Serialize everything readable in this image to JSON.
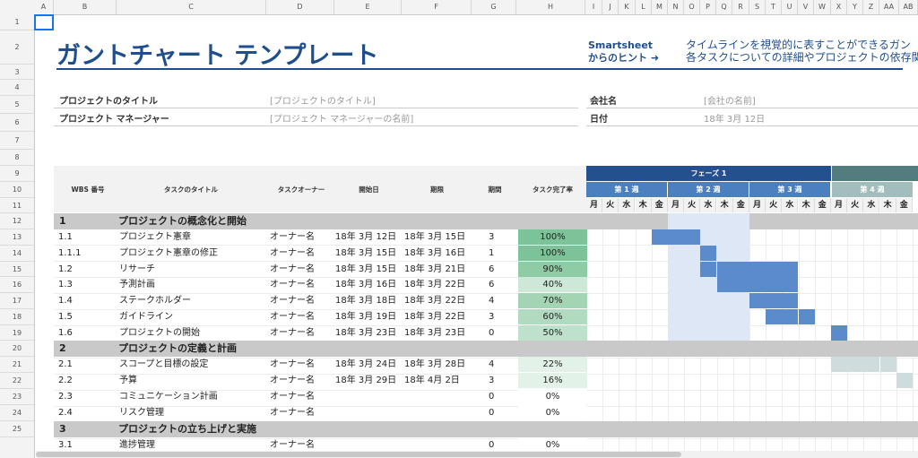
{
  "columns": [
    "A",
    "B",
    "C",
    "D",
    "E",
    "F",
    "G",
    "H",
    "I",
    "J",
    "K",
    "L",
    "M",
    "N",
    "O",
    "P",
    "Q",
    "R",
    "S",
    "T",
    "U",
    "V",
    "W",
    "X",
    "Y",
    "Z",
    "AA",
    "AB"
  ],
  "rows": [
    "1",
    "2",
    "3",
    "4",
    "5",
    "6",
    "7",
    "8",
    "9",
    "10",
    "11",
    "12",
    "13",
    "14",
    "15",
    "16",
    "17",
    "18",
    "19",
    "20",
    "21",
    "22",
    "23",
    "24",
    "25"
  ],
  "title": "ガントチャート テンプレート",
  "tip": {
    "line1": "Smartsheet",
    "line2": "からのヒント ➜",
    "text1": "タイムラインを視覚的に表すことができるガン",
    "text2": "各タスクについての詳細やプロジェクトの依存関"
  },
  "info": {
    "project_title_label": "プロジェクトのタイトル",
    "project_title_value": "[プロジェクトのタイトル]",
    "manager_label": "プロジェクト マネージャー",
    "manager_value": "[プロジェクト マネージャーの名前]",
    "company_label": "会社名",
    "company_value": "[会社の名前]",
    "date_label": "日付",
    "date_value": "18年 3月 12日"
  },
  "headers": {
    "wbs": "WBS 番号",
    "task": "タスクのタイトル",
    "owner": "タスクオーナー",
    "start": "開始日",
    "due": "期限",
    "duration": "期間",
    "pct": "タスク完了率"
  },
  "phases": [
    "フェーズ 1",
    ""
  ],
  "weeks": [
    "第 1 週",
    "第 2 週",
    "第 3 週",
    "第 4 週"
  ],
  "days": [
    "月",
    "火",
    "水",
    "木",
    "金",
    "月",
    "火",
    "水",
    "木",
    "金",
    "月",
    "火",
    "水",
    "木",
    "金",
    "月",
    "火",
    "水",
    "木",
    "金"
  ],
  "colors": {
    "accent": "#1f4e8c",
    "phase1": "#25508f",
    "phase2": "#527c7e",
    "week": "#4a7fc0",
    "week4": "#a3bdbd",
    "bar": "#5b8bcb",
    "bar_teal": "#cfdcdd",
    "highlight": "#dde7f5"
  },
  "sections": [
    {
      "wbs": "1",
      "title": "プロジェクトの概念化と開始"
    },
    {
      "wbs": "2",
      "title": "プロジェクトの定義と計画"
    },
    {
      "wbs": "3",
      "title": "プロジェクトの立ち上げと実施"
    }
  ],
  "tasks": [
    {
      "wbs": "1.1",
      "task": "プロジェクト憲章",
      "owner": "オーナー名",
      "start": "18年 3月 12日",
      "due": "18年 3月 15日",
      "duration": "3",
      "pct": "100%",
      "pct_value": 1.0
    },
    {
      "wbs": "1.1.1",
      "task": "プロジェクト憲章の修正",
      "owner": "オーナー名",
      "start": "18年 3月 15日",
      "due": "18年 3月 16日",
      "duration": "1",
      "pct": "100%",
      "pct_value": 1.0
    },
    {
      "wbs": "1.2",
      "task": "リサーチ",
      "owner": "オーナー名",
      "start": "18年 3月 15日",
      "due": "18年 3月 21日",
      "duration": "6",
      "pct": "90%",
      "pct_value": 0.9
    },
    {
      "wbs": "1.3",
      "task": "予測計画",
      "owner": "オーナー名",
      "start": "18年 3月 16日",
      "due": "18年 3月 22日",
      "duration": "6",
      "pct": "40%",
      "pct_value": 0.4
    },
    {
      "wbs": "1.4",
      "task": "ステークホルダー",
      "owner": "オーナー名",
      "start": "18年 3月 18日",
      "due": "18年 3月 22日",
      "duration": "4",
      "pct": "70%",
      "pct_value": 0.7
    },
    {
      "wbs": "1.5",
      "task": "ガイドライン",
      "owner": "オーナー名",
      "start": "18年 3月 19日",
      "due": "18年 3月 22日",
      "duration": "3",
      "pct": "60%",
      "pct_value": 0.6
    },
    {
      "wbs": "1.6",
      "task": "プロジェクトの開始",
      "owner": "オーナー名",
      "start": "18年 3月 23日",
      "due": "18年 3月 23日",
      "duration": "0",
      "pct": "50%",
      "pct_value": 0.5
    },
    {
      "wbs": "2.1",
      "task": "スコープと目標の設定",
      "owner": "オーナー名",
      "start": "18年 3月 24日",
      "due": "18年 3月 28日",
      "duration": "4",
      "pct": "22%",
      "pct_value": 0.22
    },
    {
      "wbs": "2.2",
      "task": "予算",
      "owner": "オーナー名",
      "start": "18年 3月 29日",
      "due": "18年 4月 2日",
      "duration": "3",
      "pct": "16%",
      "pct_value": 0.16
    },
    {
      "wbs": "2.3",
      "task": "コミュニケーション計画",
      "owner": "オーナー名",
      "start": "",
      "due": "",
      "duration": "0",
      "pct": "0%",
      "pct_value": 0
    },
    {
      "wbs": "2.4",
      "task": "リスク管理",
      "owner": "オーナー名",
      "start": "",
      "due": "",
      "duration": "0",
      "pct": "0%",
      "pct_value": 0
    },
    {
      "wbs": "3.1",
      "task": "進捗管理",
      "owner": "オーナー名",
      "start": "",
      "due": "",
      "duration": "0",
      "pct": "0%",
      "pct_value": 0
    }
  ]
}
